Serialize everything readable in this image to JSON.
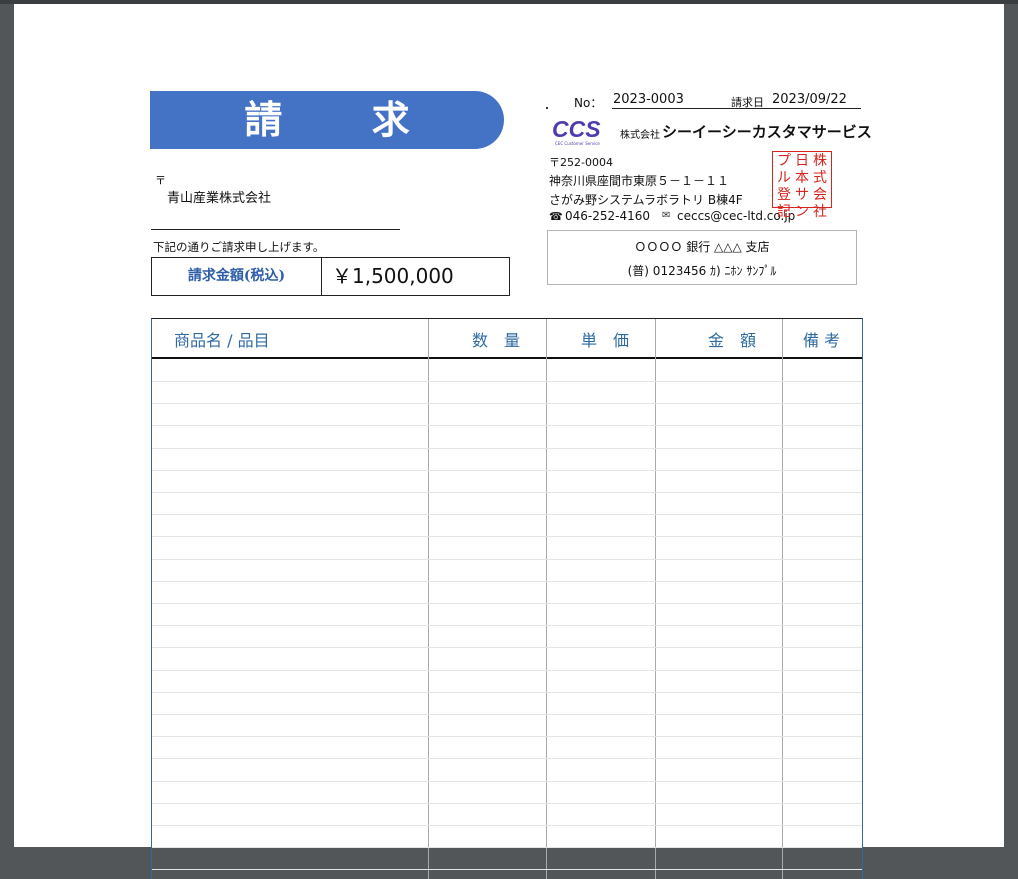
{
  "document": {
    "title": "請 求 書",
    "client_postmark": "〒",
    "client_name": "青山産業株式会社",
    "lead_text": "下記の通りご請求申し上げます。",
    "amount_label": "請求金額(税込)",
    "amount_value": "￥1,500,000"
  },
  "issuer": {
    "no_label": "No：",
    "no_value": "2023-0003",
    "date_label": "請求日",
    "date_value": "2023/09/22",
    "logo_text": "CCS",
    "logo_sub": "CEC Customer Service",
    "corp_prefix": "株式会社",
    "company_name": "シーイーシーカスタマサービス",
    "zip": "〒252-0004",
    "address1": "神奈川県座間市東原５－１－１１",
    "address2": "さがみ野システムラボラトリ B棟4F",
    "tel_icon": "☎",
    "tel": "046-252-4160",
    "mail_icon": "✉",
    "email": "ceccs@cec-ltd.co.jp",
    "seal_columns": [
      "株式会社",
      "日本サン",
      "プル登記"
    ],
    "bank_line1": "ＯＯＯＯ 銀行 △△△ 支店",
    "bank_line2": "(普) 0123456 ｶ) ﾆﾎﾝ ｻﾝﾌﾟﾙ"
  },
  "table": {
    "headers": [
      "商品名 / 品目",
      "数　量",
      "単　価",
      "金　額",
      "備 考"
    ],
    "rows": []
  },
  "colors": {
    "banner": "#4472c4",
    "header_text": "#2f6aa3",
    "logo": "#4f3bb0",
    "seal": "#d9231e"
  }
}
